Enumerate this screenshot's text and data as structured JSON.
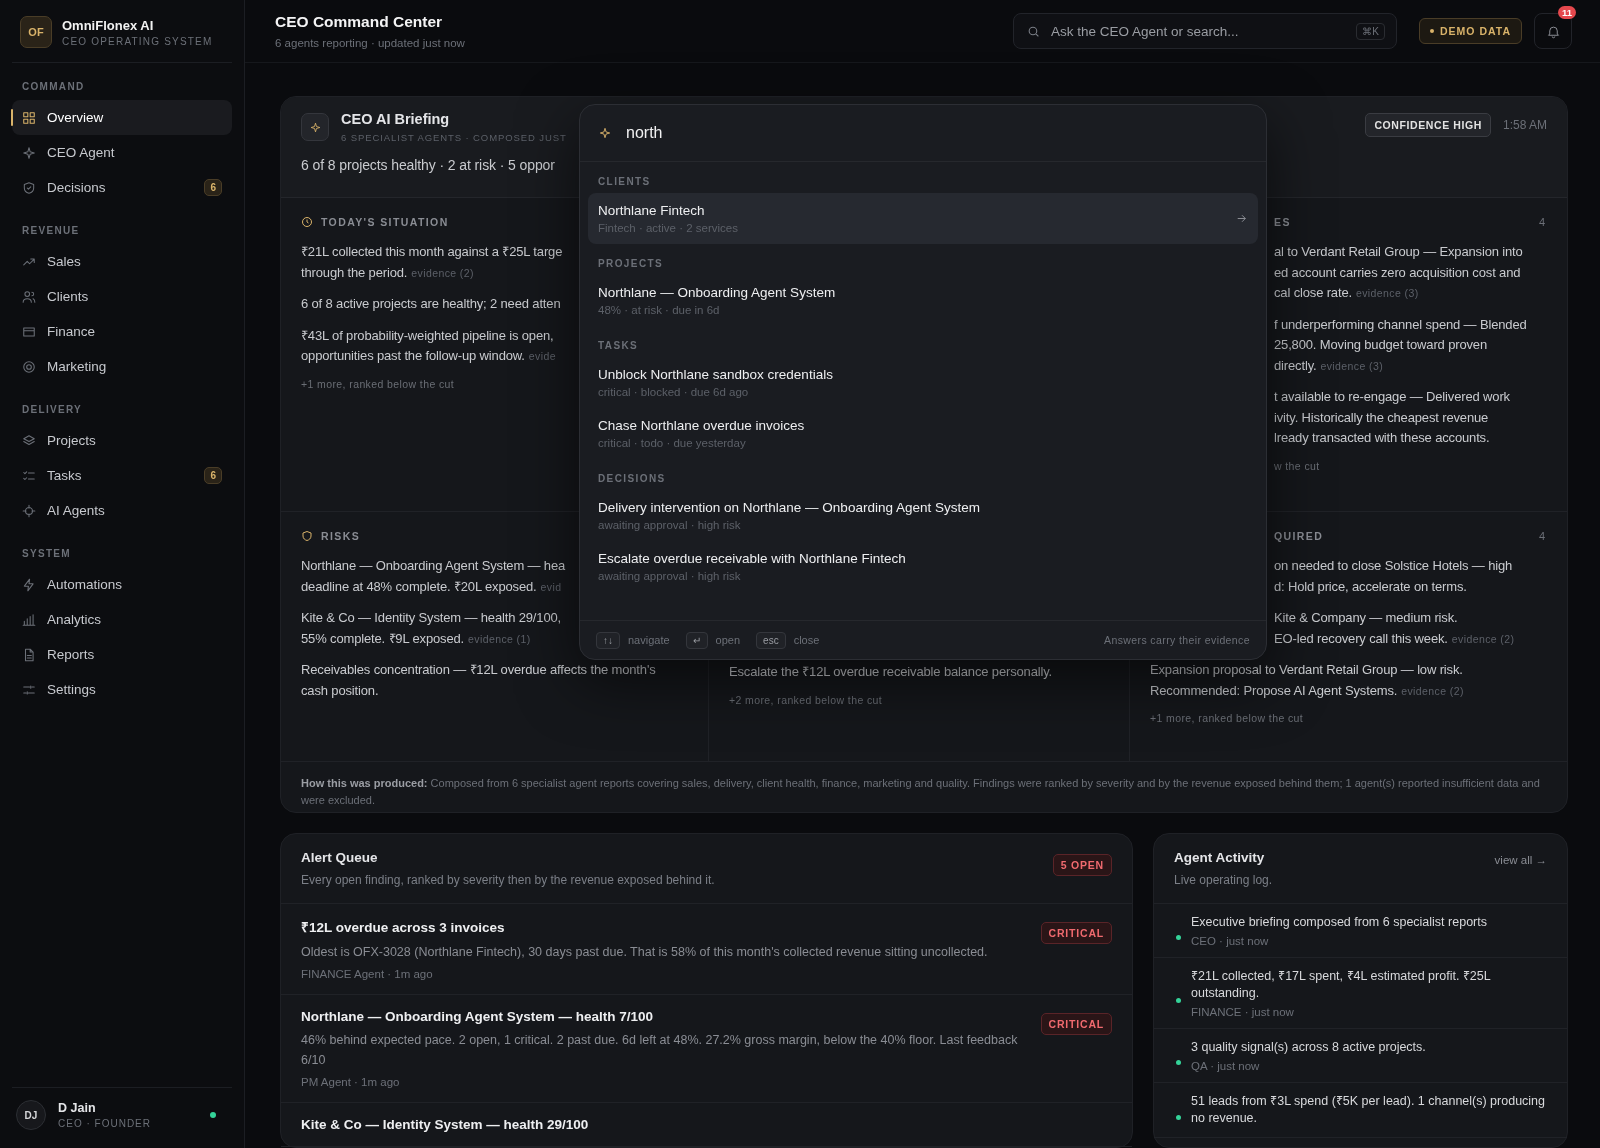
{
  "sidebar": {
    "brand": {
      "initials": "OF",
      "name": "OmniFlonex AI",
      "tagline": "CEO OPERATING SYSTEM"
    },
    "sections": [
      {
        "label": "COMMAND",
        "items": [
          {
            "label": "Overview",
            "selected": true
          },
          {
            "label": "CEO Agent",
            "selected": false
          },
          {
            "label": "Decisions",
            "selected": false,
            "badge": "6"
          }
        ]
      },
      {
        "label": "REVENUE",
        "items": [
          {
            "label": "Sales",
            "selected": false
          },
          {
            "label": "Clients",
            "selected": false
          },
          {
            "label": "Finance",
            "selected": false
          },
          {
            "label": "Marketing",
            "selected": false
          }
        ]
      },
      {
        "label": "DELIVERY",
        "items": [
          {
            "label": "Projects",
            "selected": false
          },
          {
            "label": "Tasks",
            "selected": false,
            "badge": "6"
          },
          {
            "label": "AI Agents",
            "selected": false
          }
        ]
      },
      {
        "label": "SYSTEM",
        "items": [
          {
            "label": "Automations",
            "selected": false
          },
          {
            "label": "Analytics",
            "selected": false
          },
          {
            "label": "Reports",
            "selected": false
          },
          {
            "label": "Settings",
            "selected": false
          }
        ]
      }
    ],
    "user": {
      "initials": "DJ",
      "name": "D Jain",
      "role": "CEO · FOUNDER",
      "online": true
    }
  },
  "header": {
    "title": "CEO Command Center",
    "subtitle": "6 agents reporting · updated just now",
    "search": {
      "placeholder": "Ask the CEO Agent or search...",
      "shortcut": "⌘K"
    },
    "demo_badge": "DEMO DATA",
    "notifications": "11"
  },
  "briefing": {
    "title": "CEO AI Briefing",
    "subtitle": "6 SPECIALIST AGENTS · COMPOSED JUST",
    "summary": "6 of 8 projects healthy · 2 at risk · 5 oppor",
    "confidence": "CONFIDENCE HIGH",
    "time": "1:58 AM",
    "cells": [
      {
        "kind": "left",
        "heading": "TODAY'S SITUATION",
        "items": [
          {
            "lines": [
              "₹21L collected this month against a ₹25L targe",
              "through the period."
            ],
            "evidence": "evidence (2)"
          },
          {
            "lines": [
              "6 of 8 active projects are healthy; 2 need atten"
            ]
          },
          {
            "lines": [
              "₹43L of probability-weighted pipeline is open,",
              "opportunities past the follow-up window."
            ],
            "evidence": "evide"
          }
        ],
        "more": "+1 more, ranked below the cut"
      },
      {
        "kind": "hidden"
      },
      {
        "kind": "right",
        "heading": "ES",
        "count": "4",
        "items": [
          {
            "kind": "fragment",
            "lines": [
              "al to Verdant Retail Group — Expansion into",
              "ed account carries zero acquisition cost and",
              "cal close rate."
            ],
            "evidence": "evidence (3)"
          },
          {
            "kind": "fragment",
            "lines": [
              "f underperforming channel spend — Blended",
              "25,800. Moving budget toward proven",
              "directly."
            ],
            "evidence": "evidence (3)"
          },
          {
            "kind": "fragment",
            "lines": [
              "t available to re-engage — Delivered work",
              "ivity. Historically the cheapest revenue",
              "lready transacted with these accounts."
            ]
          }
        ],
        "more": "w the cut"
      },
      {
        "kind": "left",
        "heading": "RISKS",
        "items": [
          {
            "lines": [
              "Northlane — Onboarding Agent System — hea",
              "deadline at 48% complete. ₹20L exposed."
            ],
            "evidence": "evid"
          },
          {
            "lines": [
              "Kite & Co — Identity System — health 29/100,",
              "55% complete. ₹9L exposed."
            ],
            "evidence": "evidence (1)"
          },
          {
            "lines": [
              "Receivables concentration — ₹12L overdue affects the month's",
              "cash position."
            ]
          }
        ]
      },
      {
        "kind": "bottom",
        "items": [
          {
            "lines": [
              "Escalate the ₹12L overdue receivable balance personally."
            ]
          }
        ],
        "more": "+2 more, ranked below the cut"
      },
      {
        "kind": "right_lower",
        "heading": "QUIRED",
        "count": "4",
        "items": [
          {
            "kind": "fragment",
            "lines": [
              "on needed to close Solstice Hotels — high",
              "d: Hold price, accelerate on terms."
            ]
          },
          {
            "kind": "fragment",
            "lines": [
              "Kite & Company — medium risk.",
              "EO-led recovery call this week."
            ],
            "evidence": "evidence (2)"
          },
          {
            "kind": "full",
            "lines": [
              "Expansion proposal to Verdant Retail Group — low risk.",
              "Recommended: Propose AI Agent Systems."
            ],
            "evidence": "evidence (2)"
          }
        ],
        "more": "+1 more, ranked below the cut"
      }
    ],
    "footer": "**How this was produced:** Composed from 6 specialist agent reports covering sales, delivery, client health, finance, marketing and quality. Findings were ranked by severity and by the revenue exposed behind them; 1 agent(s) reported insufficient data and were excluded."
  },
  "alerts": {
    "title": "Alert Queue",
    "subtitle": "Every open finding, ranked by severity then by the revenue exposed behind it.",
    "badge": "5 OPEN",
    "items": [
      {
        "title": "₹12L overdue across 3 invoices",
        "description": "Oldest is OFX-3028 (Northlane Fintech), 30 days past due. That is 58% of this month's collected revenue sitting uncollected.",
        "meta": "FINANCE Agent · 1m ago",
        "severity": "CRITICAL"
      },
      {
        "title": "Northlane — Onboarding Agent System — health 7/100",
        "description": "46% behind expected pace. 2 open, 1 critical. 2 past due. 6d left at 48%. 27.2% gross margin, below the 40% floor. Last feedback 6/10",
        "meta": "PM Agent · 1m ago",
        "severity": "CRITICAL"
      },
      {
        "title": "Kite & Co — Identity System — health 29/100"
      }
    ]
  },
  "activity": {
    "title": "Agent Activity",
    "subtitle": "Live operating log.",
    "link": "view all →",
    "items": [
      {
        "text": "Executive briefing composed from 6 specialist reports",
        "meta": "CEO · just now"
      },
      {
        "text": "₹21L collected, ₹17L spent, ₹4L estimated profit. ₹25L outstanding.",
        "meta": "FINANCE · just now"
      },
      {
        "text": "3 quality signal(s) across 8 active projects.",
        "meta": "QA · just now"
      },
      {
        "text": "51 leads from ₹3L spend (₹5K per lead). 1 channel(s) producing no revenue."
      }
    ]
  },
  "palette": {
    "query": "north",
    "groups": [
      {
        "label": "CLIENTS",
        "items": [
          {
            "title": "Northlane Fintech",
            "meta": "Fintech · active · 2 services",
            "selected": true
          }
        ]
      },
      {
        "label": "PROJECTS",
        "items": [
          {
            "title": "Northlane — Onboarding Agent System",
            "meta": "48% · at risk · due in 6d",
            "selected": false
          }
        ]
      },
      {
        "label": "TASKS",
        "items": [
          {
            "title": "Unblock Northlane sandbox credentials",
            "meta": "critical · blocked · due 6d ago",
            "selected": false
          },
          {
            "title": "Chase Northlane overdue invoices",
            "meta": "critical · todo · due yesterday",
            "selected": false
          }
        ]
      },
      {
        "label": "DECISIONS",
        "items": [
          {
            "title": "Delivery intervention on Northlane — Onboarding Agent System",
            "meta": "awaiting approval · high risk",
            "selected": false
          },
          {
            "title": "Escalate overdue receivable with Northlane Fintech",
            "meta": "awaiting approval · high risk",
            "selected": false
          }
        ]
      }
    ],
    "hints": [
      {
        "key": "↑↓",
        "label": "navigate"
      },
      {
        "key": "↵",
        "label": "open"
      },
      {
        "key": "esc",
        "label": "close"
      }
    ],
    "note": "Answers carry their evidence"
  }
}
